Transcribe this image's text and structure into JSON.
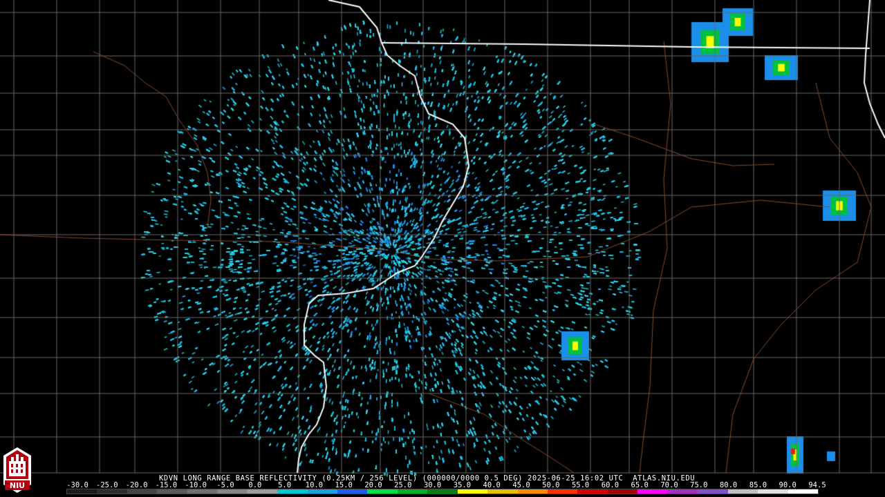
{
  "product": {
    "title_line": "KDVN LONG RANGE BASE REFLECTIVITY (0.25KM / 256 LEVEL) (000000/0000 0.5 DEG) 2025-06-25 16:02 UTC  ATLAS.NIU.EDU",
    "logo_text": "NIU"
  },
  "map": {
    "background_color": "#000000",
    "county_border_color": "#6b6b6b",
    "river_color": "#8a4a2a",
    "state_border_color": "#ffffff",
    "radar_site": "KDVN"
  },
  "scale": {
    "labels": [
      "-30.0",
      "-25.0",
      "-20.0",
      "-15.0",
      "-10.0",
      "-5.0",
      "0.0",
      "5.0",
      "10.0",
      "15.0",
      "20.0",
      "25.0",
      "30.0",
      "35.0",
      "40.0",
      "45.0",
      "50.0",
      "55.0",
      "60.0",
      "65.0",
      "70.0",
      "75.0",
      "80.0",
      "85.0",
      "90.0",
      "94.5"
    ],
    "colors": [
      "#1a1a1a",
      "#2e2e2e",
      "#444444",
      "#5a5a5a",
      "#707070",
      "#868686",
      "#9c9c9c",
      "#00c8d0",
      "#1aa0e0",
      "#2060e8",
      "#00e040",
      "#00b020",
      "#008010",
      "#ffff00",
      "#e8c000",
      "#ff8c00",
      "#ff3000",
      "#d00000",
      "#a00000",
      "#ff00ff",
      "#a030c0",
      "#8050d0",
      "#c0c0c0",
      "#e0e0e0",
      "#ffffff"
    ]
  }
}
